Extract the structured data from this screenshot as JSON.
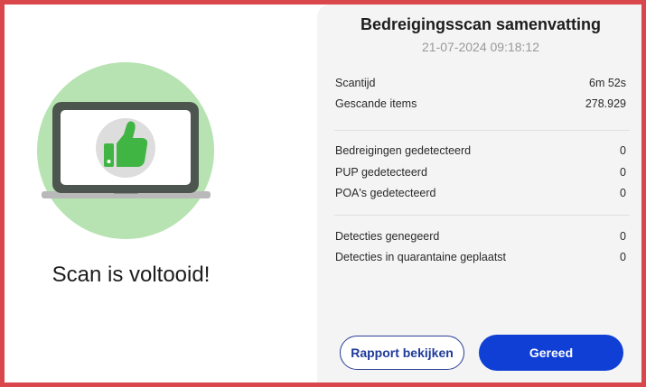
{
  "left_panel": {
    "illustration_icon": "laptop-thumbs-up-icon",
    "completion_title": "Scan is voltooid!"
  },
  "summary": {
    "title": "Bedreigingsscan samenvatting",
    "datetime": "21-07-2024 09:18:12",
    "group1": [
      {
        "label": "Scantijd",
        "value": "6m 52s"
      },
      {
        "label": "Gescande items",
        "value": "278.929"
      }
    ],
    "group2": [
      {
        "label": "Bedreigingen gedetecteerd",
        "value": "0"
      },
      {
        "label": "PUP gedetecteerd",
        "value": "0"
      },
      {
        "label": "POA's gedetecteerd",
        "value": "0"
      }
    ],
    "group3": [
      {
        "label": "Detecties genegeerd",
        "value": "0"
      },
      {
        "label": "Detecties in quarantaine geplaatst",
        "value": "0"
      }
    ]
  },
  "actions": {
    "view_report": "Rapport bekijken",
    "done": "Gereed"
  },
  "colors": {
    "frame_border": "#d9474d",
    "primary_button": "#0f3fd4",
    "success_green": "#41b544",
    "circle_green": "#b6e3b1"
  }
}
